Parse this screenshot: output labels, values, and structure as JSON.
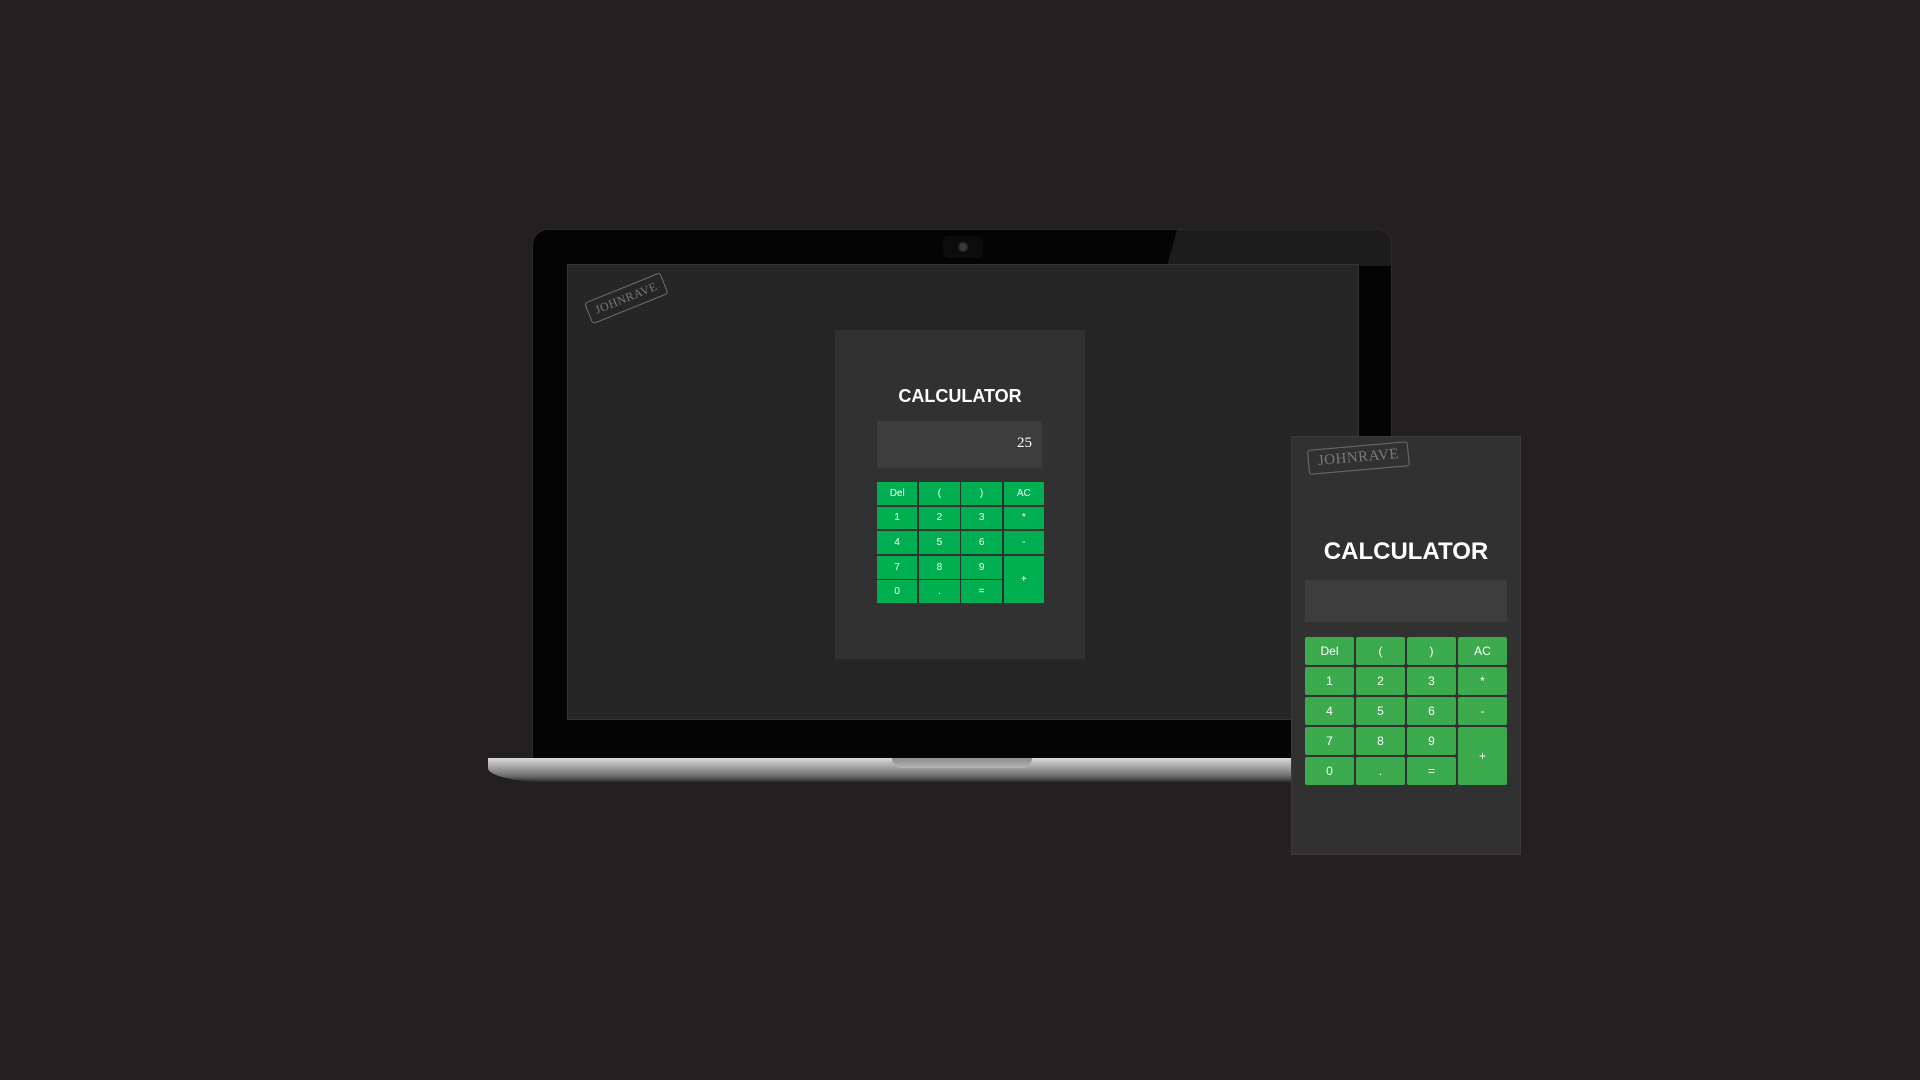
{
  "colors": {
    "background": "#242021",
    "panel": "#313131",
    "display": "#3d3d3d",
    "desktop_button": "#00b050",
    "mobile_button": "#3cab4e",
    "text": "#ffffff"
  },
  "watermark": {
    "text": "JOHNRAVE"
  },
  "desktop": {
    "title": "CALCULATOR",
    "display_value": "25",
    "buttons": [
      {
        "label": "Del",
        "name": "del-button"
      },
      {
        "label": "(",
        "name": "open-paren-button"
      },
      {
        "label": ")",
        "name": "close-paren-button"
      },
      {
        "label": "AC",
        "name": "ac-button"
      },
      {
        "label": "1",
        "name": "digit-1-button"
      },
      {
        "label": "2",
        "name": "digit-2-button"
      },
      {
        "label": "3",
        "name": "digit-3-button"
      },
      {
        "label": "*",
        "name": "multiply-button"
      },
      {
        "label": "4",
        "name": "digit-4-button"
      },
      {
        "label": "5",
        "name": "digit-5-button"
      },
      {
        "label": "6",
        "name": "digit-6-button"
      },
      {
        "label": "-",
        "name": "minus-button"
      },
      {
        "label": "7",
        "name": "digit-7-button"
      },
      {
        "label": "8",
        "name": "digit-8-button"
      },
      {
        "label": "9",
        "name": "digit-9-button"
      },
      {
        "label": "+",
        "name": "plus-button"
      },
      {
        "label": "0",
        "name": "digit-0-button"
      },
      {
        "label": ".",
        "name": "decimal-button"
      },
      {
        "label": "=",
        "name": "equals-button"
      }
    ]
  },
  "mobile": {
    "title": "CALCULATOR",
    "display_value": "",
    "buttons": [
      {
        "label": "Del",
        "name": "del-button"
      },
      {
        "label": "(",
        "name": "open-paren-button"
      },
      {
        "label": ")",
        "name": "close-paren-button"
      },
      {
        "label": "AC",
        "name": "ac-button"
      },
      {
        "label": "1",
        "name": "digit-1-button"
      },
      {
        "label": "2",
        "name": "digit-2-button"
      },
      {
        "label": "3",
        "name": "digit-3-button"
      },
      {
        "label": "*",
        "name": "multiply-button"
      },
      {
        "label": "4",
        "name": "digit-4-button"
      },
      {
        "label": "5",
        "name": "digit-5-button"
      },
      {
        "label": "6",
        "name": "digit-6-button"
      },
      {
        "label": "-",
        "name": "minus-button"
      },
      {
        "label": "7",
        "name": "digit-7-button"
      },
      {
        "label": "8",
        "name": "digit-8-button"
      },
      {
        "label": "9",
        "name": "digit-9-button"
      },
      {
        "label": "+",
        "name": "plus-button"
      },
      {
        "label": "0",
        "name": "digit-0-button"
      },
      {
        "label": ".",
        "name": "decimal-button"
      },
      {
        "label": "=",
        "name": "equals-button"
      }
    ]
  }
}
